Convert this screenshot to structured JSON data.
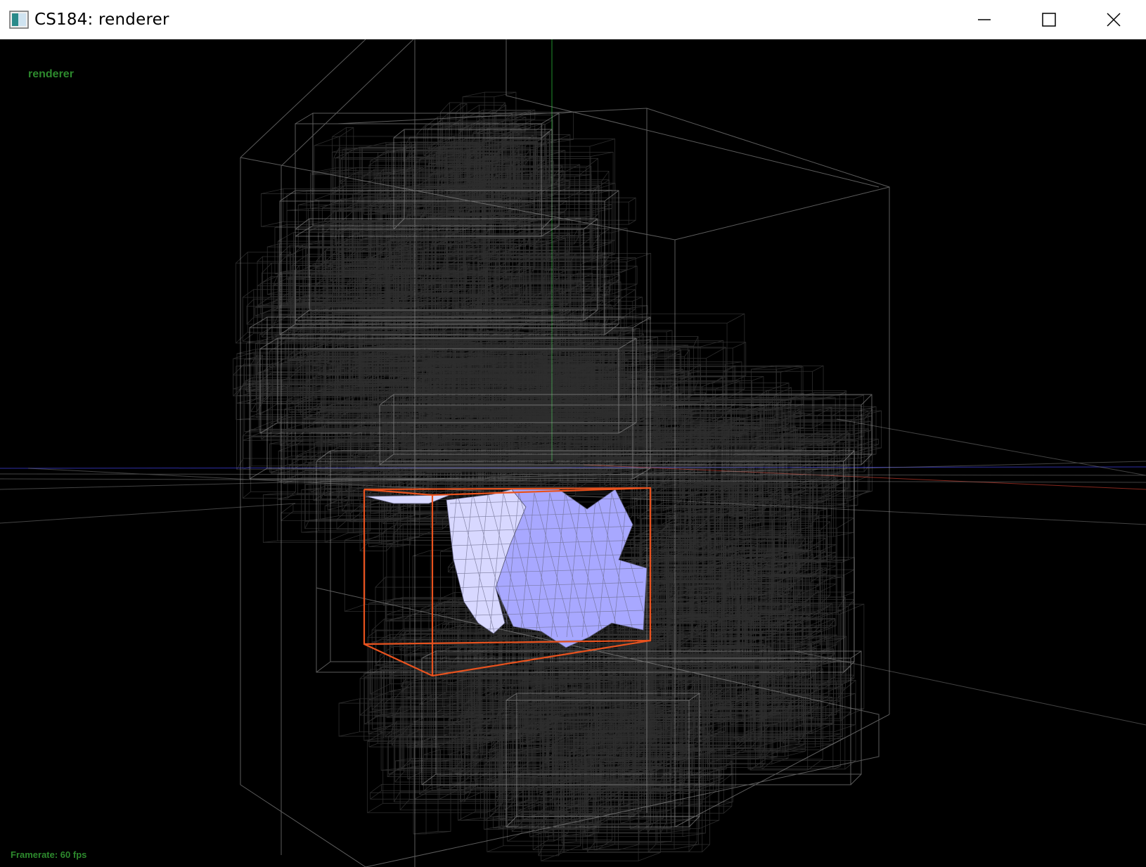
{
  "window": {
    "title": "CS184: renderer",
    "icon": "app-window-icon",
    "controls": [
      "minimize-icon",
      "maximize-icon",
      "close-icon"
    ]
  },
  "viewport": {
    "overlay_title": "renderer",
    "framerate_label": "Framerate: 60 fps",
    "colors": {
      "background": "#000000",
      "bvh_boxes": "#9a9a9a",
      "selected_box": "#e8521e",
      "mesh_fill": "#a8a8ff",
      "mesh_light": "#d8d8ff",
      "overlay_text": "#2d8a2d",
      "axis_x": "#c0392b",
      "axis_y": "#2ecc40",
      "axis_z": "#3b3bd0"
    }
  }
}
